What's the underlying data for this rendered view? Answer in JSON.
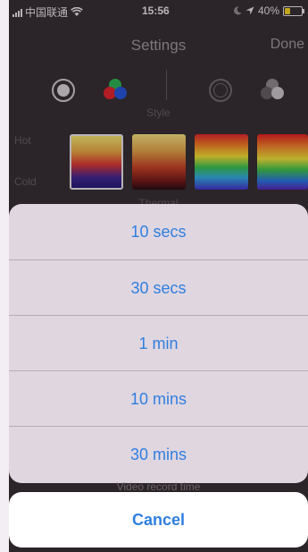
{
  "status_bar": {
    "carrier": "中国联通",
    "time": "15:56",
    "battery_percent": "40%",
    "battery_level": 0.4,
    "icons": [
      "signal-icon",
      "wifi-icon",
      "moon-icon",
      "location-arrow-icon",
      "battery-icon"
    ],
    "battery_color": "#f4d31a"
  },
  "nav": {
    "title": "Settings",
    "done_label": "Done"
  },
  "style_section": {
    "label": "Style",
    "options": [
      "white-circle",
      "rgb-circles",
      "white-circle",
      "gray-circles"
    ]
  },
  "heat_scale": {
    "hot_label": "Hot",
    "cold_label": "Cold"
  },
  "palette_section": {
    "label": "Thermal"
  },
  "action_sheet": {
    "options": [
      {
        "label": "10 secs"
      },
      {
        "label": "30 secs"
      },
      {
        "label": "1 min"
      },
      {
        "label": "10 mins"
      },
      {
        "label": "30 mins"
      }
    ],
    "footer_label": "Video record time",
    "cancel_label": "Cancel"
  },
  "colors": {
    "accent": "#2f7fe0",
    "sheet_bg": "#e8dee8",
    "app_bg": "#2c2629"
  }
}
